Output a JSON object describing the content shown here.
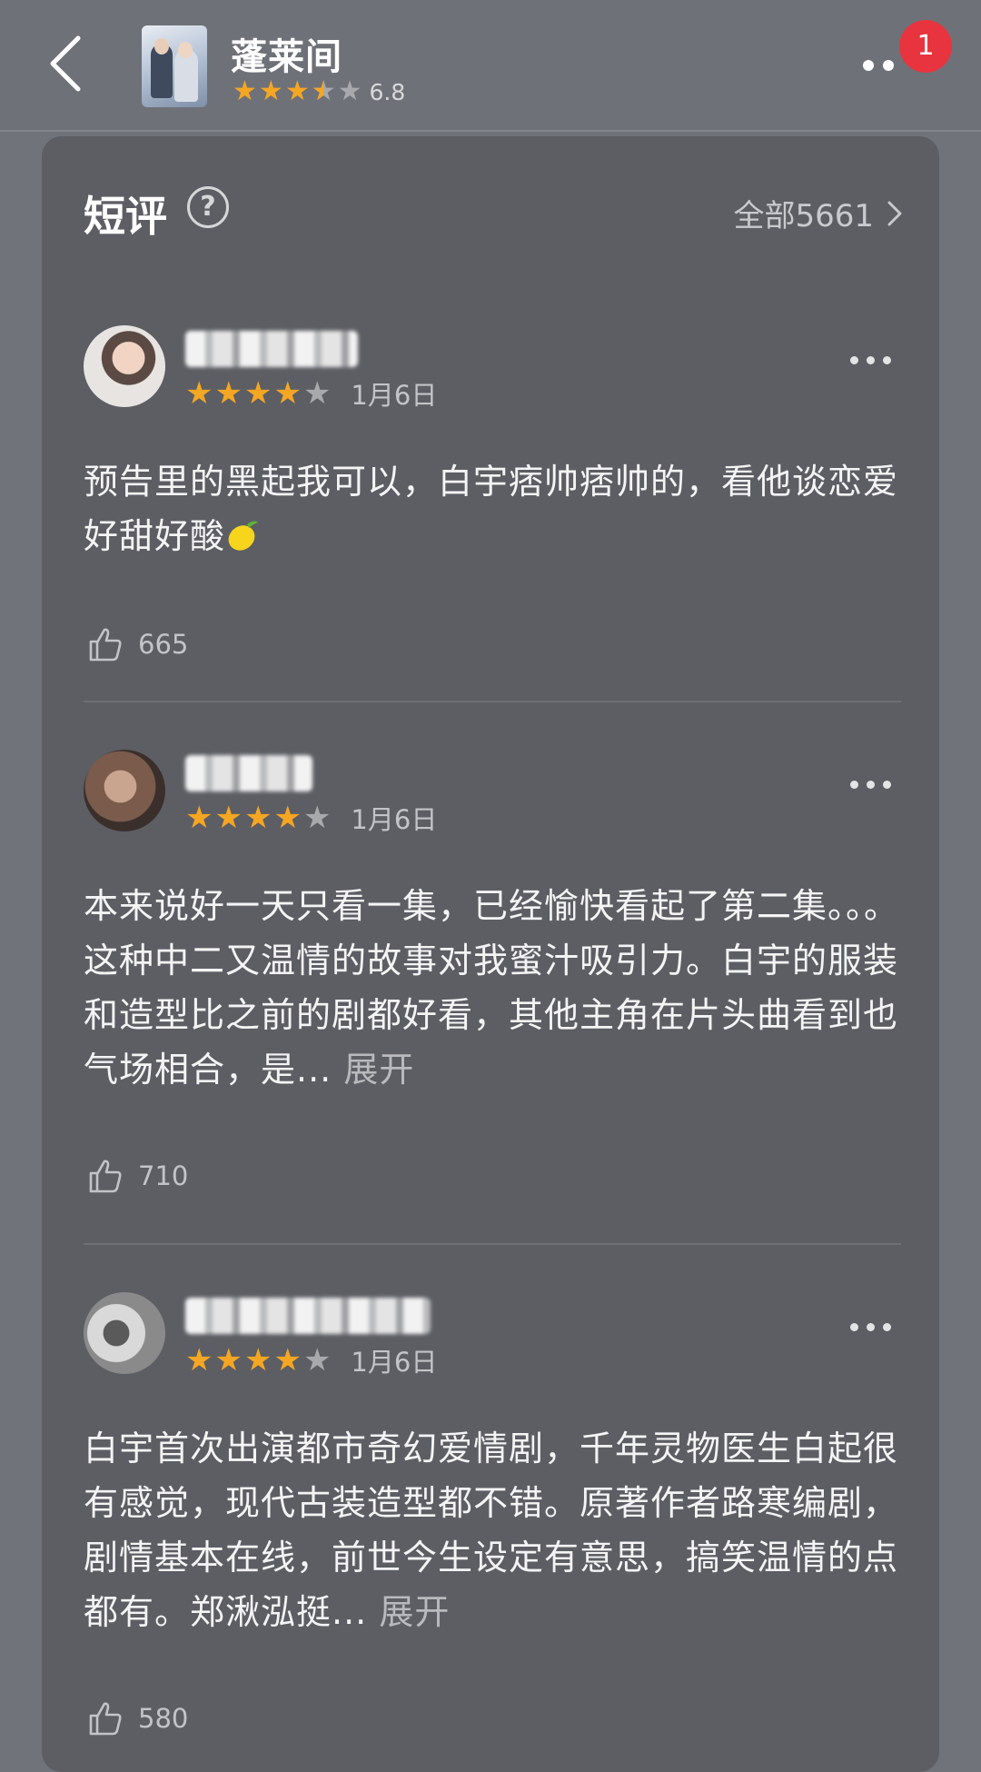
{
  "header": {
    "title": "蓬莱间",
    "rating_score": "6.8",
    "rating_stars": 3.5,
    "notification_count": "1"
  },
  "section": {
    "title": "短评",
    "see_all_label": "全部5661"
  },
  "reviews": [
    {
      "username": "■■■■■■",
      "stars": 4,
      "date": "1月6日",
      "text": "预告里的黑起我可以，白宇痞帅痞帅的，看他谈恋爱好甜好酸",
      "has_lemon_emoji": true,
      "expand_label": "",
      "likes": "665"
    },
    {
      "username": "■■■■",
      "stars": 4,
      "date": "1月6日",
      "text": "本来说好一天只看一集，已经愉快看起了第二集。。。这种中二又温情的故事对我蜜汁吸引力。白宇的服装和造型比之前的剧都好看，其他主角在片头曲看到也气场相合，是...",
      "expand_label": "展开",
      "likes": "710"
    },
    {
      "username": "■■■■■■■■",
      "stars": 4,
      "date": "1月6日",
      "text": "白宇首次出演都市奇幻爱情剧，千年灵物医生白起很有感觉，现代古装造型都不错。原著作者路寒编剧，剧情基本在线，前世今生设定有意思，搞笑温情的点都有。郑湫泓挺...",
      "expand_label": "展开",
      "likes": "580"
    }
  ],
  "colors": {
    "star_on": "#f5a623",
    "star_off": "#a8a9ad",
    "badge": "#e8343f",
    "card_bg": "#5c5e64",
    "page_bg": "#71737a"
  }
}
